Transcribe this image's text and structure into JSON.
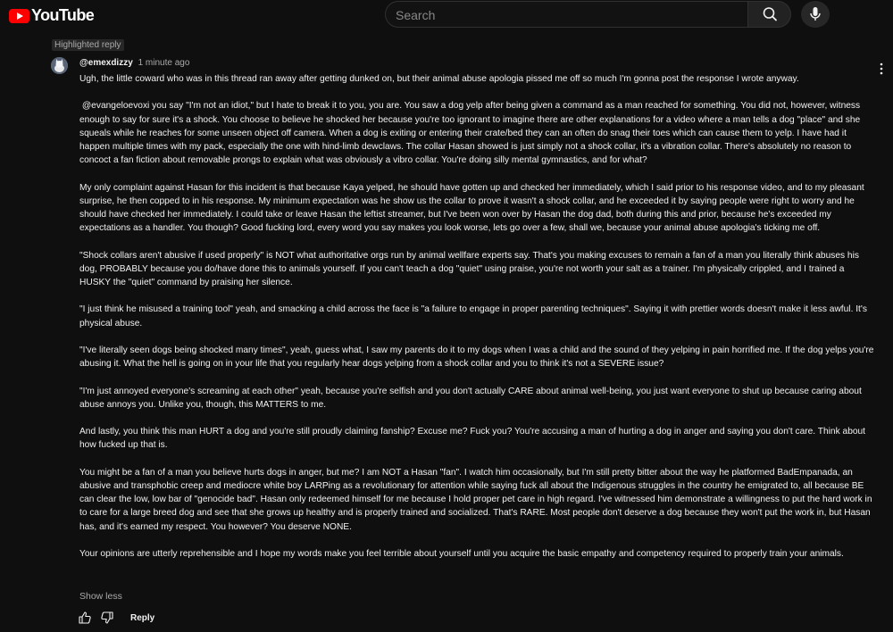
{
  "header": {
    "logo_text": "YouTube",
    "search_placeholder": "Search"
  },
  "comment": {
    "badge": "Highlighted reply",
    "author": "@emexdizzy",
    "time": "1 minute ago",
    "paragraphs": [
      "Ugh, the little coward who was in this thread ran away after getting dunked on, but their animal abuse apologia pissed me off so much I'm gonna post the response I wrote anyway.",
      " @evangeloevoxi you say \"I'm not an idiot,\" but I hate to break it to you, you are. You saw a dog yelp after being given a command as a man reached for something. You did not, however, witness enough to say for sure it's a shock. You choose to believe he shocked her because you're too ignorant to imagine there are other explanations for a video where a man tells a dog \"place\" and she squeals while he reaches for some unseen object off camera. When a dog is exiting or entering their crate/bed they can an often do snag their toes which can cause them to yelp. I have had it happen multiple times with my pack, especially the one with hind-limb dewclaws. The collar Hasan showed is just simply not a shock collar, it's a vibration collar. There's absolutely no reason to concoct a fan fiction about removable prongs to explain what was obviously a vibro collar. You're doing silly mental gymnastics, and for what?",
      "My only complaint against Hasan for this incident is that because Kaya yelped, he should have gotten up and checked her immediately, which I said prior to his response video, and to my pleasant surprise, he then copped to in his response. My minimum expectation was he show us the collar to prove it wasn't a shock collar, and he exceeded it by saying people were right to worry and he should have checked her immediately. I could take or leave Hasan the leftist streamer, but I've been won over by Hasan the dog dad, both during this and prior, because he's exceeded my expectations as a handler. You though? Good fucking lord, every word you say makes you look worse, lets go over a few, shall we, because your animal abuse apologia's ticking me off.",
      "\"Shock collars aren't abusive if used properly\" is NOT what authoritative orgs run by animal wellfare experts say. That's you making excuses to remain a fan of a man you literally think abuses his dog, PROBABLY because you do/have done this to animals yourself. If you can't teach a dog \"quiet\" using praise, you're not worth your salt as a trainer. I'm physically crippled, and I trained a HUSKY the \"quiet\" command by praising her silence.",
      "\"I just think he misused a training tool\" yeah, and smacking a child across the face is \"a failure to engage in proper parenting techniques\". Saying it with prettier words doesn't make it less awful. It's physical abuse.",
      "\"I've literally seen dogs being shocked many times\", yeah, guess what, I saw my parents do it to my dogs when I was a child and the sound of they yelping in pain horrified me. If the dog yelps you're abusing it. What the hell is going on in your life that you regularly hear dogs yelping from a shock collar and you to think it's not a SEVERE issue?",
      "\"I'm just annoyed everyone's screaming at each other\" yeah, because you're selfish and you don't actually CARE about animal well-being, you just want everyone to shut up because caring about abuse annoys you. Unlike you, though, this MATTERS to me.",
      "And lastly, you think this man HURT a dog and you're still proudly claiming fanship? Excuse me? Fuck you? You're accusing a man of hurting a dog in anger and saying you don't care. Think about how fucked up that is.",
      "You might be a fan of a man you believe hurts dogs in anger, but me? I am NOT a Hasan \"fan\". I watch him occasionally, but I'm still pretty bitter about the way he platformed BadEmpanada, an abusive and transphobic creep and mediocre white boy LARPing as a revolutionary for attention while saying fuck all about the Indigenous struggles in the country he emigrated to, all because BE can clear the low, low bar of \"genocide bad\". Hasan only redeemed himself for me because I hold proper pet care in high regard. I've witnessed him demonstrate a willingness to put the hard work in to care for a large breed dog and see that she grows up healthy and is properly trained and socialized. That's RARE. Most people don't deserve a dog because they won't put the work in, but Hasan has, and it's earned my respect. You however? You deserve NONE.",
      "Your opinions are utterly reprehensible and I hope my words make you feel terrible about yourself until you acquire the basic empathy and competency required to properly train your animals."
    ],
    "show_less": "Show less",
    "reply_label": "Reply"
  }
}
